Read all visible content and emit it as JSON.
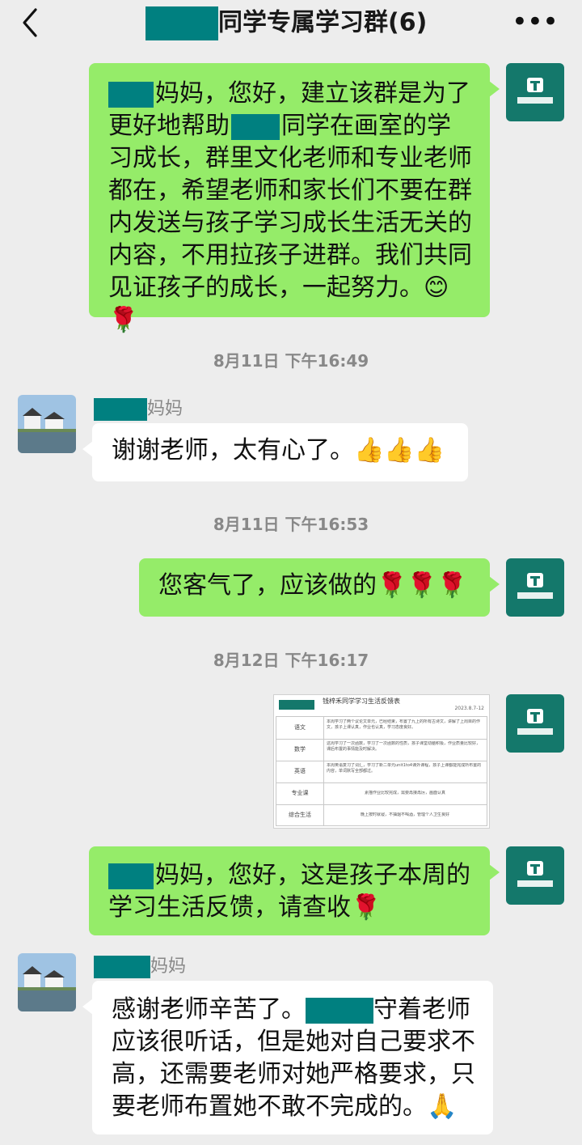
{
  "header": {
    "title_suffix": "同学专属学习群(6)",
    "more_label": "•••"
  },
  "messages": {
    "m1": {
      "redact_prefix": "",
      "text_a": "妈妈，您好，建立该群是为了更好地帮助",
      "text_b": "同学在画室的学习成长，群里文化老师和专业老师都在，希望老师和家长们不要在群内发送与孩子学习成长生活无关的内容，不用拉孩子进群。我们共同见证孩子的成长，一起努力。",
      "emojis": "😊🌹"
    },
    "t1": "8月11日 下午16:49",
    "m2": {
      "sender_suffix": "妈妈",
      "text": "谢谢老师，太有心了。",
      "emojis": "👍👍👍"
    },
    "t2": "8月11日 下午16:53",
    "m3": {
      "text": "您客气了，应该做的",
      "emojis": "🌹🌹🌹"
    },
    "t3": "8月12日 下午16:17",
    "m4": {
      "doc_title": "钱梓禾同学学习生活反馈表",
      "doc_date": "2023.8.7-12",
      "doc_rows": [
        {
          "label": "语文",
          "content": "本周学习了两个议论文单元，已经结束，布置了九上的所有古诗文，讲解了上周目的作文，孩子上课认真，作业也认真，学习态度良好。"
        },
        {
          "label": "数学",
          "content": "这周学习了一次函数，学习了一次函数的性质，孩子课堂动脑积极，作业质量比较好，课后布置的事情能及时解决。"
        },
        {
          "label": "英语",
          "content": "本周英语复习了词汇，学习了新二单元unit1to4课外课程，孩子上课都能完成所布置的内容，单词默写全部都过。"
        },
        {
          "label": "专业课",
          "content": "素描作业比较完成，需要再接再厉，画面认真"
        },
        {
          "label": "综合生活",
          "content": "晚上按时就寝，不抽烟不喝酒，管理个人卫生良好"
        }
      ]
    },
    "m5": {
      "text_a": "妈妈，您好，这是孩子本周的学习生活反馈，请查收",
      "emojis": "🌹"
    },
    "m6": {
      "sender_suffix": "妈妈",
      "text_a": "感谢老师辛苦了。",
      "text_b": "守着老师应该很听话，但是她对自己要求不高，还需要老师对她严格要求，只要老师布置她不敢不完成的。",
      "emojis": "🙏"
    }
  },
  "colors": {
    "background": "#ededed",
    "bubble_self": "#95ec69",
    "bubble_other": "#ffffff",
    "redaction": "#008080",
    "brand_avatar": "#14786b"
  },
  "icons": {
    "back": "chevron-left-icon",
    "more": "more-dots-icon",
    "brand_avatar": "brand-logo-avatar",
    "user_avatar": "landscape-photo-avatar"
  }
}
